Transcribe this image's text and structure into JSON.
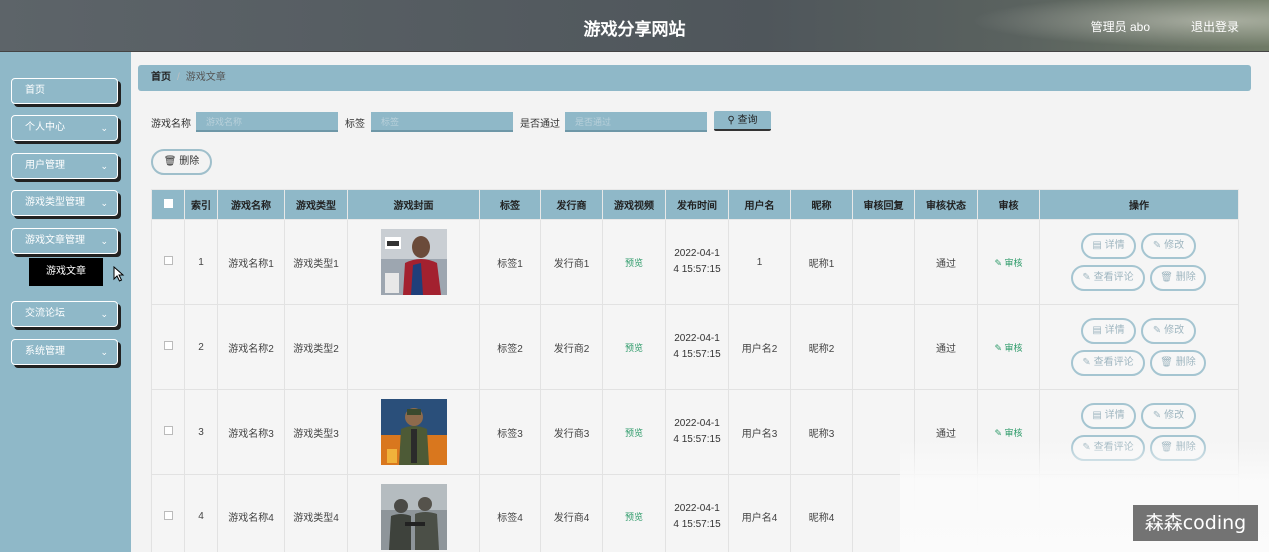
{
  "header": {
    "title": "游戏分享网站",
    "user": "管理员 abo",
    "logout": "退出登录"
  },
  "sidebar": {
    "items": [
      {
        "label": "首页",
        "chevron": ""
      },
      {
        "label": "个人中心",
        "chevron": "⌄"
      },
      {
        "label": "用户管理",
        "chevron": "⌄"
      },
      {
        "label": "游戏类型管理",
        "chevron": "⌄"
      },
      {
        "label": "游戏文章管理",
        "chevron": "⌄"
      },
      {
        "label": "交流论坛",
        "chevron": "⌄"
      },
      {
        "label": "系统管理",
        "chevron": "⌄"
      }
    ],
    "submenu": "游戏文章"
  },
  "breadcrumb": {
    "home": "首页",
    "sep": "/",
    "current": "游戏文章"
  },
  "filters": {
    "name_label": "游戏名称",
    "name_placeholder": "游戏名称",
    "tag_label": "标签",
    "tag_placeholder": "标签",
    "pass_label": "是否通过",
    "pass_placeholder": "是否通过",
    "search": "查询"
  },
  "delete_label": "删除",
  "table": {
    "headers": [
      "",
      "索引",
      "游戏名称",
      "游戏类型",
      "游戏封面",
      "标签",
      "发行商",
      "游戏视频",
      "发布时间",
      "用户名",
      "昵称",
      "审核回复",
      "审核状态",
      "审核",
      "操作"
    ],
    "rows": [
      {
        "index": "1",
        "name": "游戏名称1",
        "type": "游戏类型1",
        "cover": "fifa",
        "tag": "标签1",
        "publisher": "发行商1",
        "video": "预览",
        "date1": "2022-04-1",
        "date2": "4 15:57:15",
        "username": "1",
        "nickname": "昵称1",
        "reply": "",
        "status": "通过",
        "audit": "审核"
      },
      {
        "index": "2",
        "name": "游戏名称2",
        "type": "游戏类型2",
        "cover": "",
        "tag": "标签2",
        "publisher": "发行商2",
        "video": "预览",
        "date1": "2022-04-1",
        "date2": "4 15:57:15",
        "username": "用户名2",
        "nickname": "昵称2",
        "reply": "",
        "status": "通过",
        "audit": "审核"
      },
      {
        "index": "3",
        "name": "游戏名称3",
        "type": "游戏类型3",
        "cover": "pubg",
        "tag": "标签3",
        "publisher": "发行商3",
        "video": "预览",
        "date1": "2022-04-1",
        "date2": "4 15:57:15",
        "username": "用户名3",
        "nickname": "昵称3",
        "reply": "",
        "status": "通过",
        "audit": "审核"
      },
      {
        "index": "4",
        "name": "游戏名称4",
        "type": "游戏类型4",
        "cover": "soldiers",
        "tag": "标签4",
        "publisher": "发行商4",
        "video": "预览",
        "date1": "2022-04-1",
        "date2": "4 15:57:15",
        "username": "用户名4",
        "nickname": "昵称4",
        "reply": "",
        "status": "",
        "audit": ""
      }
    ],
    "ops": {
      "detail": "详情",
      "edit": "修改",
      "comments": "查看评论",
      "delete": "删除"
    }
  },
  "watermark": "森森coding"
}
